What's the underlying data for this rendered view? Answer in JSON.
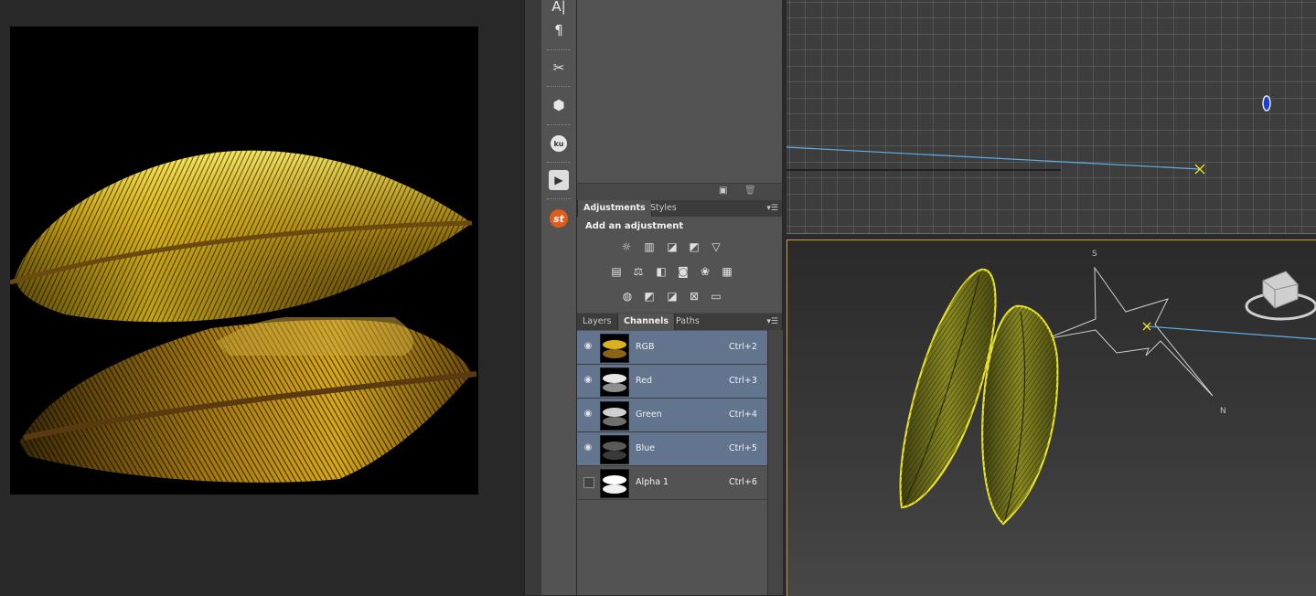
{
  "panels": {
    "adjustments": {
      "tabs": [
        "Adjustments",
        "Styles"
      ],
      "active_tab": "Adjustments",
      "title": "Add an adjustment",
      "rows": [
        [
          "brightness-contrast-icon",
          "levels-icon",
          "curves-icon",
          "exposure-icon",
          "vibrance-icon"
        ],
        [
          "hue-saturation-icon",
          "color-balance-icon",
          "black-white-icon",
          "photo-filter-icon",
          "channel-mixer-icon",
          "color-lookup-icon"
        ],
        [
          "invert-icon",
          "posterize-icon",
          "threshold-icon",
          "selective-color-icon",
          "gradient-map-icon"
        ]
      ]
    },
    "layers_group": {
      "tabs": [
        "Layers",
        "Channels",
        "Paths"
      ],
      "active_tab": "Channels"
    },
    "channels": [
      {
        "name": "RGB",
        "shortcut": "Ctrl+2",
        "visible": true,
        "selected": true
      },
      {
        "name": "Red",
        "shortcut": "Ctrl+3",
        "visible": true,
        "selected": true
      },
      {
        "name": "Green",
        "shortcut": "Ctrl+4",
        "visible": true,
        "selected": true
      },
      {
        "name": "Blue",
        "shortcut": "Ctrl+5",
        "visible": true,
        "selected": true
      },
      {
        "name": "Alpha 1",
        "shortcut": "Ctrl+6",
        "visible": false,
        "selected": false
      }
    ]
  },
  "viewport_bottom": {
    "compass": {
      "south": "S",
      "north": "N"
    }
  },
  "colors": {
    "panel_bg": "#535353",
    "selected_row": "#62748e",
    "viewport_border": "#caa23a",
    "leaf_yellow": "#d8d23a"
  }
}
